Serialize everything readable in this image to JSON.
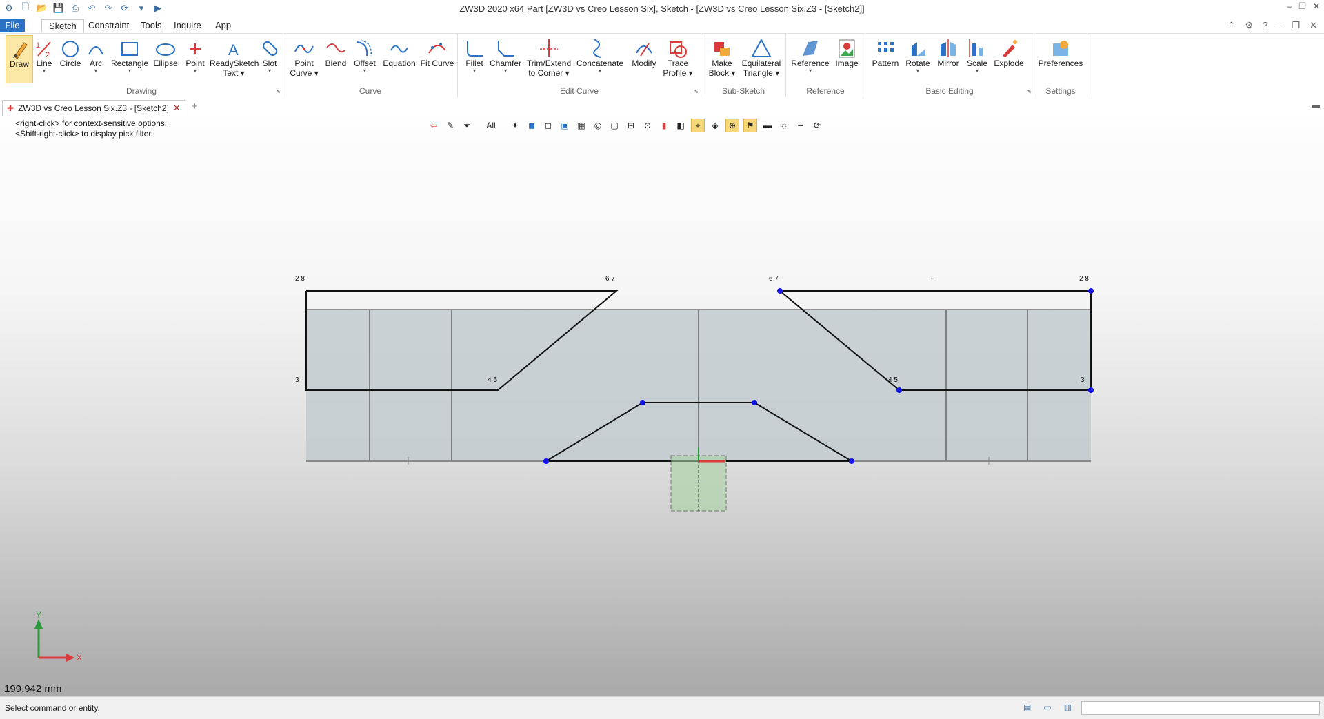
{
  "window": {
    "title": "ZW3D 2020 x64        Part [ZW3D vs Creo Lesson Six],  Sketch - [ZW3D vs Creo Lesson Six.Z3 - [Sketch2]]"
  },
  "menu": {
    "file": "File",
    "tabs": [
      "Sketch",
      "Constraint",
      "Tools",
      "Inquire",
      "App"
    ]
  },
  "ribbon": {
    "groups": [
      "Drawing",
      "Curve",
      "Edit Curve",
      "Sub-Sketch",
      "Reference",
      "Basic Editing",
      "Settings"
    ],
    "tools": [
      {
        "l1": "Draw",
        "l2": ""
      },
      {
        "l1": "Line",
        "l2": ""
      },
      {
        "l1": "Circle",
        "l2": ""
      },
      {
        "l1": "Arc",
        "l2": ""
      },
      {
        "l1": "Rectangle",
        "l2": ""
      },
      {
        "l1": "Ellipse",
        "l2": ""
      },
      {
        "l1": "Point",
        "l2": ""
      },
      {
        "l1": "ReadySketch",
        "l2": "Text"
      },
      {
        "l1": "Slot",
        "l2": ""
      },
      {
        "l1": "Point",
        "l2": "Curve"
      },
      {
        "l1": "Blend",
        "l2": ""
      },
      {
        "l1": "Offset",
        "l2": ""
      },
      {
        "l1": "Equation",
        "l2": ""
      },
      {
        "l1": "Fit Curve",
        "l2": ""
      },
      {
        "l1": "Fillet",
        "l2": ""
      },
      {
        "l1": "Chamfer",
        "l2": ""
      },
      {
        "l1": "Trim/Extend",
        "l2": "to Corner"
      },
      {
        "l1": "Concatenate",
        "l2": ""
      },
      {
        "l1": "Modify",
        "l2": ""
      },
      {
        "l1": "Trace",
        "l2": "Profile"
      },
      {
        "l1": "Make",
        "l2": "Block"
      },
      {
        "l1": "Equilateral",
        "l2": "Triangle"
      },
      {
        "l1": "Reference",
        "l2": ""
      },
      {
        "l1": "Image",
        "l2": ""
      },
      {
        "l1": "Pattern",
        "l2": ""
      },
      {
        "l1": "Rotate",
        "l2": ""
      },
      {
        "l1": "Mirror",
        "l2": ""
      },
      {
        "l1": "Scale",
        "l2": ""
      },
      {
        "l1": "Explode",
        "l2": ""
      },
      {
        "l1": "Preferences",
        "l2": ""
      }
    ]
  },
  "document_tab": {
    "label": "ZW3D vs Creo Lesson Six.Z3 - [Sketch2]"
  },
  "viewport": {
    "hint1": "<right-click> for context-sensitive options.",
    "hint2": "<Shift-right-click> to display pick filter.",
    "filter_label": "All",
    "dimension_readout": "199.942 mm",
    "axis_x": "X",
    "axis_y": "Y",
    "constraints": {
      "tl": "2  8",
      "tm": "6  7",
      "tr1": "6  7",
      "tr2": "2  8",
      "ml": "3",
      "mm": "4  5",
      "mr1": "4  5",
      "mr2": "3",
      "dash": "–"
    }
  },
  "status": {
    "message": "Select command or entity."
  },
  "colors": {
    "accent": "#2b72c4",
    "highlight": "#f6d77a",
    "point": "#1414e6",
    "sketch_line": "#111111"
  }
}
